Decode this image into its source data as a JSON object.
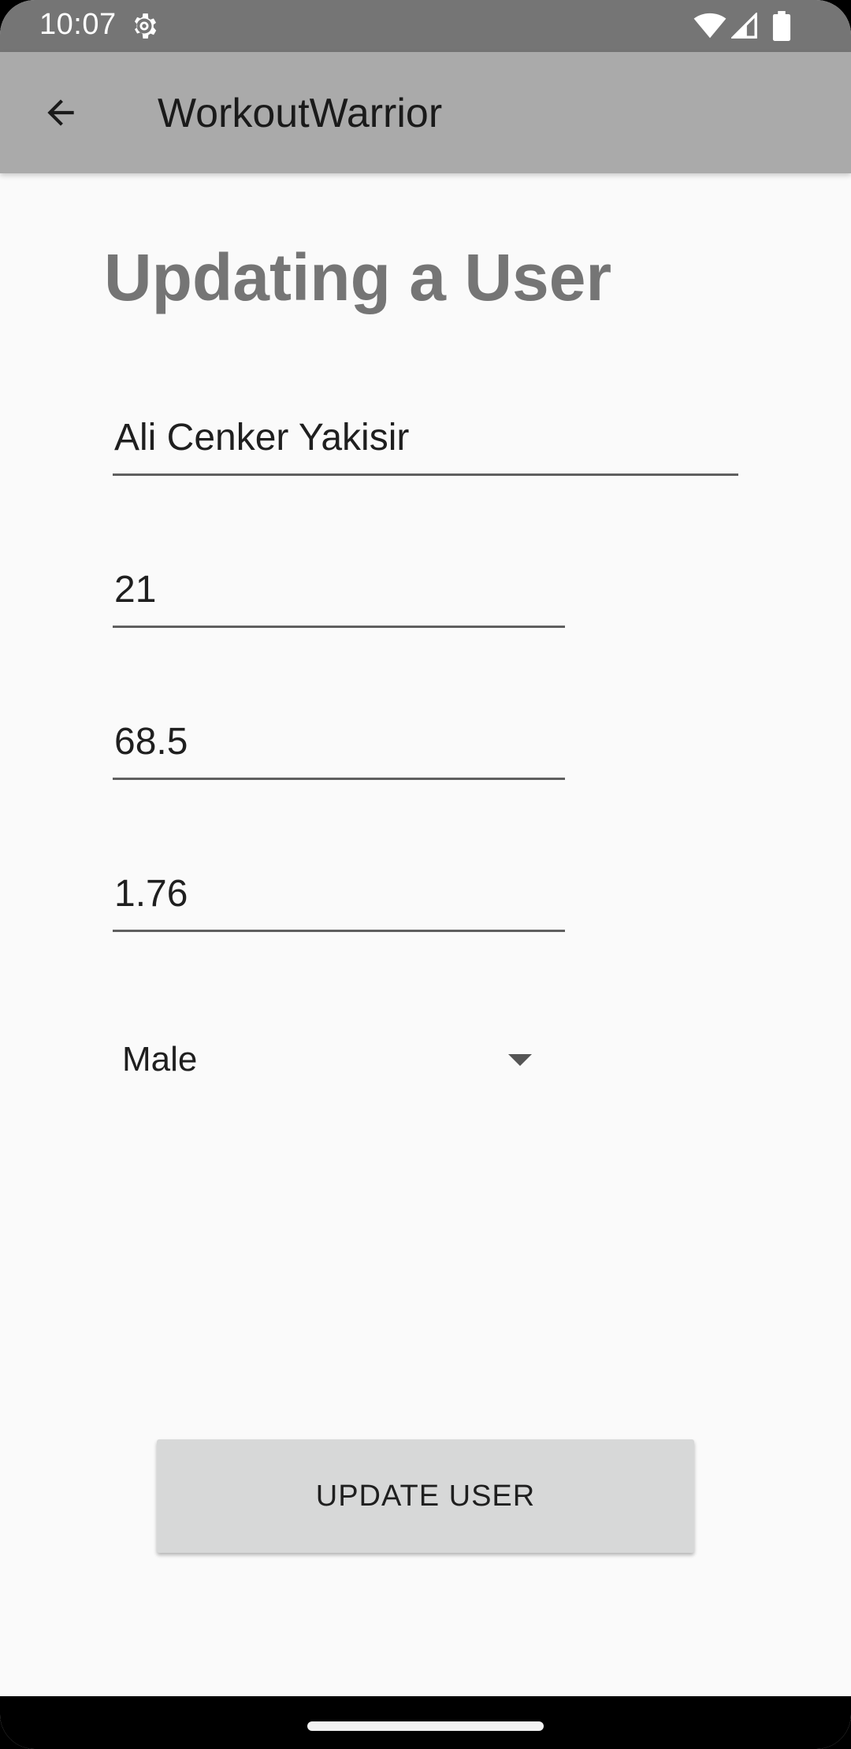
{
  "status_bar": {
    "time": "10:07",
    "icons": [
      "settings-gear-icon",
      "wifi-icon",
      "cell-signal-icon",
      "battery-icon"
    ]
  },
  "app_bar": {
    "title": "WorkoutWarrior",
    "back_icon": "arrow-back-icon"
  },
  "page": {
    "title": "Updating a User"
  },
  "form": {
    "name_value": "Ali Cenker Yakisir",
    "age_value": "21",
    "weight_value": "68.5",
    "height_value": "1.76",
    "gender_selected": "Male"
  },
  "actions": {
    "update_label": "UPDATE USER"
  },
  "colors": {
    "status_bar": "#757575",
    "app_bar": "#aaaaaa",
    "background": "#fafafa",
    "title_text": "#757575",
    "button": "#d7d8d8"
  }
}
